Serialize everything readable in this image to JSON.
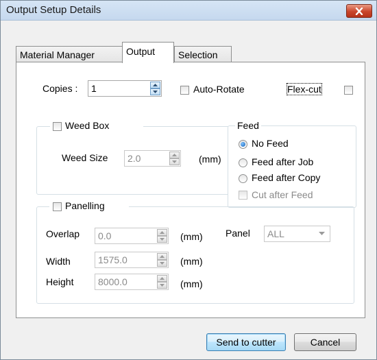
{
  "window": {
    "title": "Output Setup Details"
  },
  "tabs": [
    {
      "label": "Material Manager"
    },
    {
      "label": "Output"
    },
    {
      "label": "Selection"
    }
  ],
  "copies": {
    "label": "Copies :",
    "value": "1"
  },
  "auto_rotate": {
    "label": "Auto-Rotate",
    "checked": false
  },
  "flex_cut": {
    "label": "Flex-cut",
    "checked": false
  },
  "weed_box": {
    "label": "Weed Box",
    "checked": false,
    "weed_size_label": "Weed Size",
    "weed_size_value": "2.0",
    "unit": "(mm)"
  },
  "feed": {
    "label": "Feed",
    "options": [
      {
        "label": "No Feed",
        "selected": true
      },
      {
        "label": "Feed after Job",
        "selected": false
      },
      {
        "label": "Feed after Copy",
        "selected": false
      }
    ],
    "cut_after_feed_label": "Cut after Feed"
  },
  "panelling": {
    "label": "Panelling",
    "checked": false,
    "overlap_label": "Overlap",
    "overlap_value": "0.0",
    "width_label": "Width",
    "width_value": "1575.0",
    "height_label": "Height",
    "height_value": "8000.0",
    "unit": "(mm)",
    "panel_label": "Panel",
    "panel_value": "ALL"
  },
  "buttons": {
    "send_label": "Send to cutter",
    "cancel_label": "Cancel"
  }
}
